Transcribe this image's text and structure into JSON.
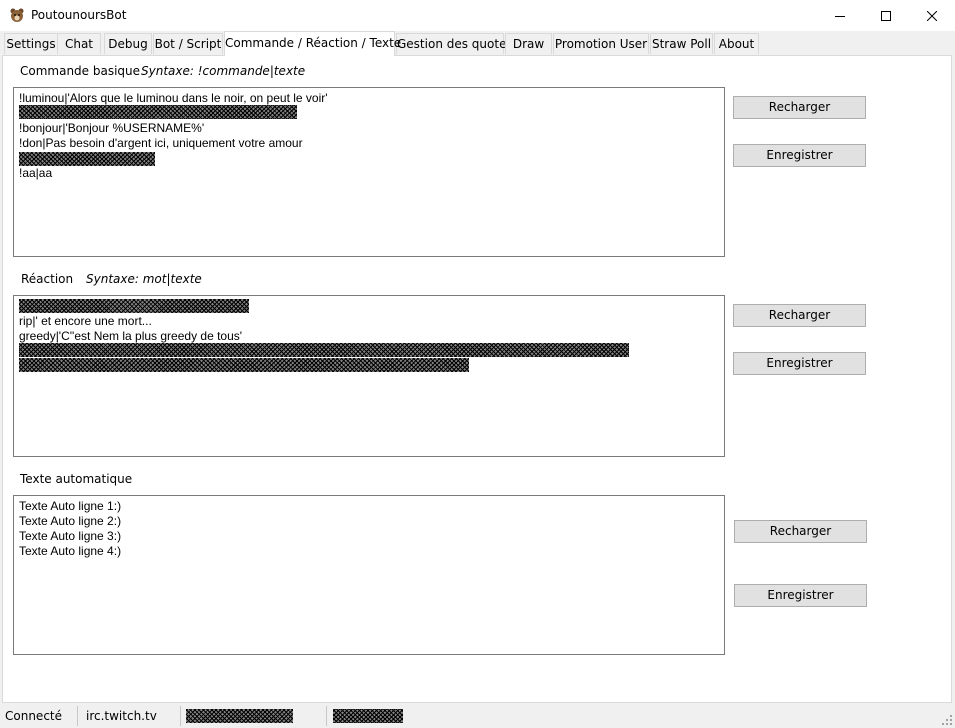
{
  "window": {
    "title": "PoutounoursBot",
    "app_icon": "bear-icon",
    "controls": [
      "minimize-icon",
      "maximize-icon",
      "close-icon"
    ]
  },
  "tabs": [
    {
      "label": "Settings",
      "active": false
    },
    {
      "label": "Chat",
      "active": false
    },
    {
      "label": "Debug",
      "active": false
    },
    {
      "label": "Bot / Script",
      "active": false
    },
    {
      "label": "Commande / Réaction / Texte",
      "active": true
    },
    {
      "label": "Gestion des quotes",
      "active": false
    },
    {
      "label": "Draw",
      "active": false
    },
    {
      "label": "Promotion User",
      "active": false
    },
    {
      "label": "Straw Poll",
      "active": false
    },
    {
      "label": "About",
      "active": false
    }
  ],
  "commandes": {
    "label": "Commande basique",
    "syntax": "Syntaxe: !commande|texte",
    "lines": [
      "!luminou|'Alors que le luminou dans le noir, on peut le voir'",
      "!bonjour|'Bonjour %USERNAME%'",
      "!don|Pas besoin d'argent ici, uniquement votre amour",
      "!aa|aa"
    ],
    "reload_label": "Recharger",
    "save_label": "Enregistrer"
  },
  "reactions": {
    "label": "Réaction",
    "syntax": "Syntaxe: mot|texte",
    "lines": [
      "rip|' et encore une mort...",
      "greedy|'C''est Nem la plus greedy de tous'"
    ],
    "reload_label": "Recharger",
    "save_label": "Enregistrer"
  },
  "texte_auto": {
    "label": "Texte automatique",
    "lines": [
      "Texte Auto ligne 1:)",
      "Texte Auto ligne 2:)",
      "Texte Auto ligne 3:)",
      "Texte Auto ligne 4:)"
    ],
    "reload_label": "Recharger",
    "save_label": "Enregistrer"
  },
  "status": {
    "connection": "Connecté",
    "server": "irc.twitch.tv"
  }
}
